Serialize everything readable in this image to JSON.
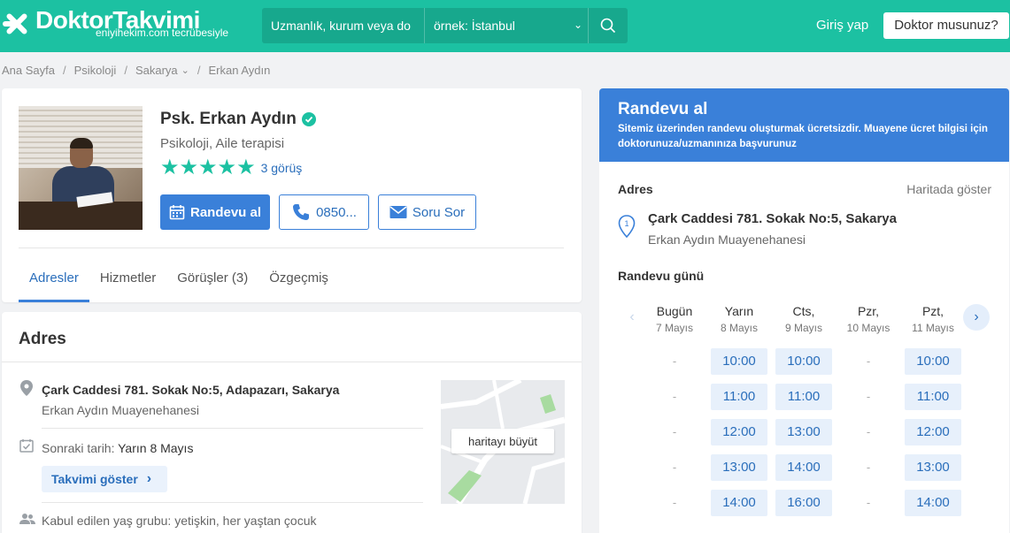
{
  "header": {
    "logo_text": "DoktorTakvimi",
    "logo_sub": "eniyihekim.com tecrübesiyle",
    "search_spec_placeholder": "Uzmanlık, kurum veya do",
    "search_loc_placeholder": "örnek: İstanbul",
    "login_label": "Giriş yap",
    "doctor_label": "Doktor musunuz?",
    "brand_color": "#1cc1a2"
  },
  "breadcrumb": [
    "Ana Sayfa",
    "Psikoloji",
    "Sakarya",
    "Erkan Aydın"
  ],
  "profile": {
    "name": "Psk. Erkan Aydın",
    "specialty": "Psikoloji, Aile terapisi",
    "rating_stars": 5,
    "reviews_label": "3 görüş",
    "book_label": "Randevu al",
    "phone_label": "0850...",
    "ask_label": "Soru Sor",
    "tabs": [
      "Adresler",
      "Hizmetler",
      "Görüşler (3)",
      "Özgeçmiş"
    ]
  },
  "address": {
    "title": "Adres",
    "street": "Çark Caddesi 781. Sokak No:5, Adapazarı, Sakarya",
    "place": "Erkan Aydın Muayenehanesi",
    "next_date_label": "Sonraki tarih:",
    "next_date_value": "Yarın 8 Mayıs",
    "show_calendar_label": "Takvimi göster",
    "map_button_label": "haritayı büyüt",
    "age_group": "Kabul edilen yaş grubu: yetişkin, her yaştan çocuk"
  },
  "booking": {
    "title": "Randevu al",
    "info": "Sitemiz üzerinden randevu oluşturmak ücretsizdir. Muayene ücret bilgisi için doktorunuza/uzmanınıza başvurunuz",
    "address_label": "Adres",
    "map_link": "Haritada göster",
    "street": "Çark Caddesi 781. Sokak No:5, Sakarya",
    "place": "Erkan Aydın Muayenehanesi",
    "day_label": "Randevu günü",
    "days": [
      {
        "name": "Bugün",
        "date": "7 Mayıs",
        "slots": [
          "-",
          "-",
          "-",
          "-",
          "-"
        ]
      },
      {
        "name": "Yarın",
        "date": "8 Mayıs",
        "slots": [
          "10:00",
          "11:00",
          "12:00",
          "13:00",
          "14:00"
        ]
      },
      {
        "name": "Cts,",
        "date": "9 Mayıs",
        "slots": [
          "10:00",
          "11:00",
          "13:00",
          "14:00",
          "16:00"
        ]
      },
      {
        "name": "Pzr,",
        "date": "10 Mayıs",
        "slots": [
          "-",
          "-",
          "-",
          "-",
          "-"
        ]
      },
      {
        "name": "Pzt,",
        "date": "11 Mayıs",
        "slots": [
          "10:00",
          "11:00",
          "12:00",
          "13:00",
          "14:00"
        ]
      }
    ]
  }
}
